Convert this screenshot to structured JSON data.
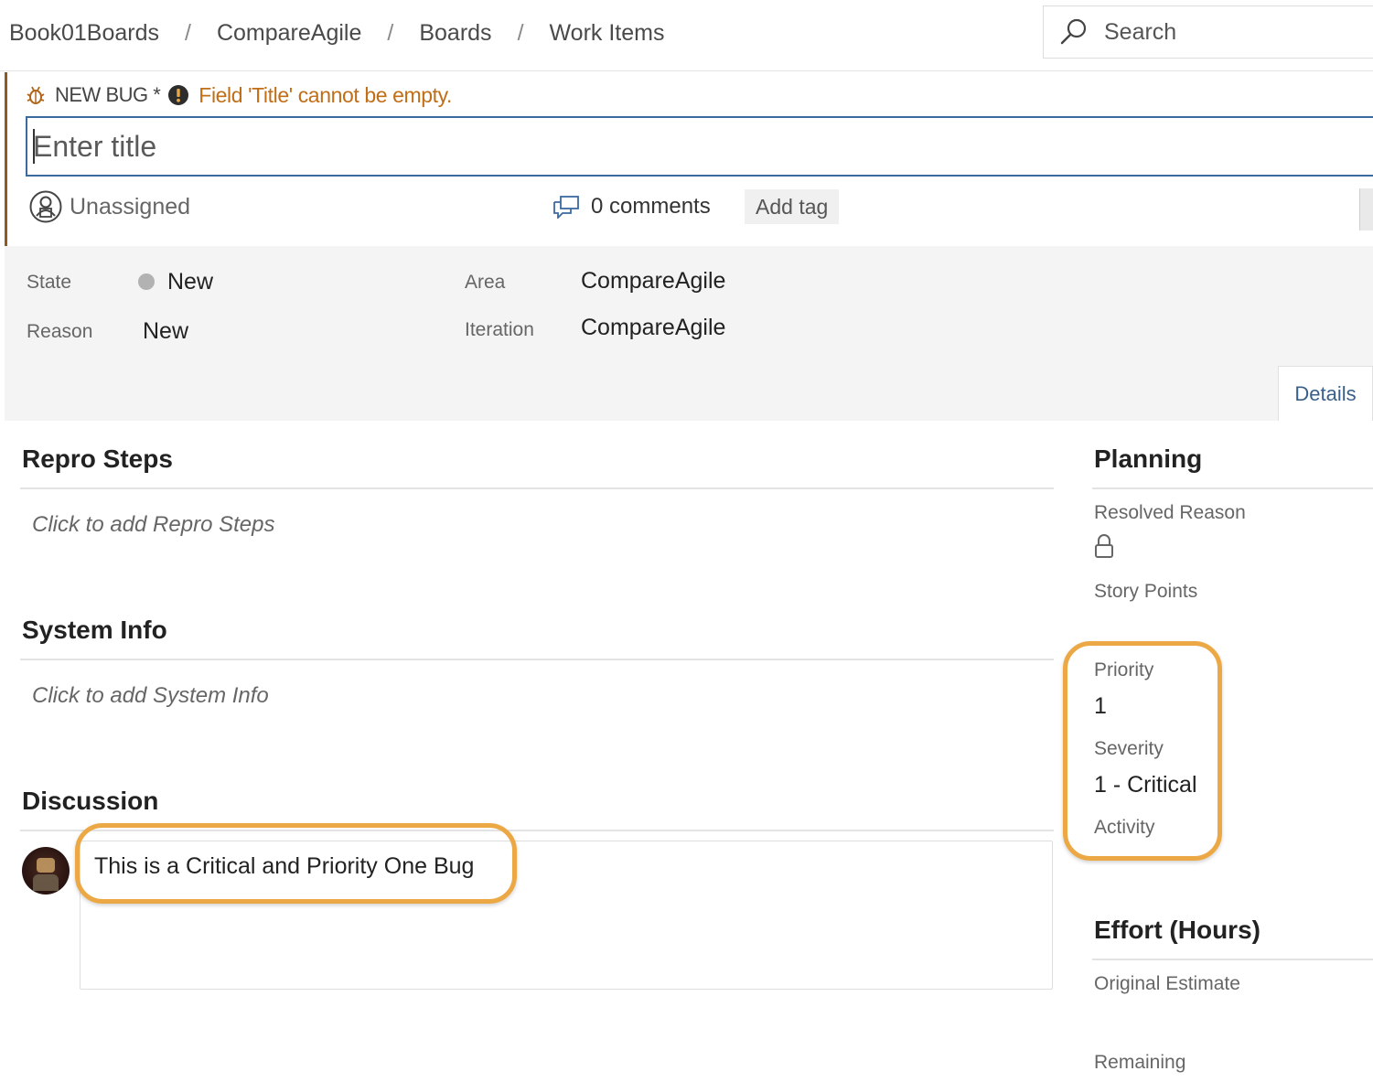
{
  "breadcrumb": [
    "Book01Boards",
    "CompareAgile",
    "Boards",
    "Work Items"
  ],
  "search": {
    "label": "Search"
  },
  "work_item": {
    "type_label": "NEW BUG *",
    "error_message": "Field 'Title' cannot be empty.",
    "title_placeholder": "Enter title",
    "assignee": "Unassigned",
    "comments": "0 comments",
    "add_tag": "Add tag"
  },
  "fields": {
    "state_label": "State",
    "state_value": "New",
    "reason_label": "Reason",
    "reason_value": "New",
    "area_label": "Area",
    "area_value": "CompareAgile",
    "iteration_label": "Iteration",
    "iteration_value": "CompareAgile"
  },
  "tabs": {
    "details": "Details"
  },
  "sections": {
    "repro_title": "Repro Steps",
    "repro_placeholder": "Click to add Repro Steps",
    "sysinfo_title": "System Info",
    "sysinfo_placeholder": "Click to add System Info",
    "discussion_title": "Discussion",
    "discussion_text": "This is a Critical and Priority One Bug"
  },
  "planning": {
    "title": "Planning",
    "resolved_reason_label": "Resolved Reason",
    "story_points_label": "Story Points",
    "priority_label": "Priority",
    "priority_value": "1",
    "severity_label": "Severity",
    "severity_value": "1 - Critical",
    "activity_label": "Activity"
  },
  "effort": {
    "title": "Effort (Hours)",
    "original_estimate_label": "Original Estimate",
    "remaining_label": "Remaining"
  },
  "colors": {
    "accent_warning": "#c06e17",
    "highlight_ring": "#eba845",
    "title_border": "#3b6aa0",
    "state_dot": "#b2b2b2"
  }
}
